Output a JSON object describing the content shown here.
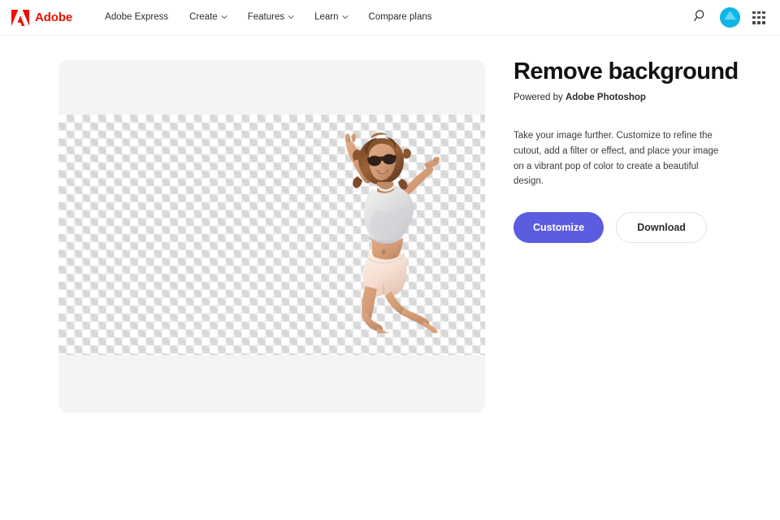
{
  "header": {
    "brand": {
      "name": "Adobe",
      "logo_icon": "adobe-a-logo-icon",
      "color": "#eb1000"
    },
    "nav_items": [
      {
        "label": "Adobe Express",
        "has_chevron": false
      },
      {
        "label": "Create",
        "has_chevron": true
      },
      {
        "label": "Features",
        "has_chevron": true
      },
      {
        "label": "Learn",
        "has_chevron": true
      },
      {
        "label": "Compare plans",
        "has_chevron": false
      }
    ],
    "actions": {
      "search_icon": "search-icon",
      "avatar_icon": "user-avatar",
      "avatar_color": "#10b5e8",
      "app_switcher_icon": "app-grid-icon"
    }
  },
  "canvas": {
    "name": "image-preview-canvas",
    "background_color": "#f4f4f4",
    "transparency_pattern": "checkerboard",
    "checker_color": "#d8d8d8",
    "subject_alt": "Woman jumping with arms raised, background removed"
  },
  "panel": {
    "title": "Remove background",
    "powered_prefix": "Powered by",
    "powered_brand": "Adobe Photoshop",
    "description": "Take your image further. Customize to refine the cutout, add a filter or effect, and place your image on a vibrant pop of color to create a beautiful design.",
    "primary_button": {
      "label": "Customize",
      "color": "#5c5ce0"
    },
    "secondary_button": {
      "label": "Download",
      "color": "#ffffff"
    }
  }
}
